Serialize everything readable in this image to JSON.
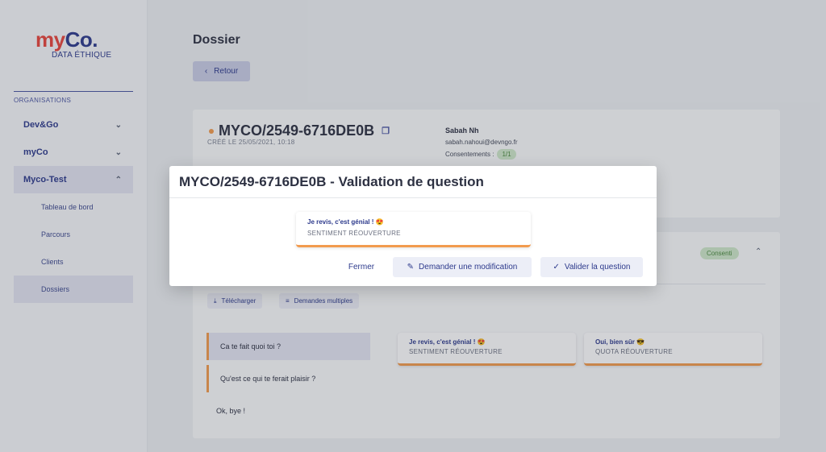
{
  "sidebar": {
    "logo_my": "my",
    "logo_co": "Co.",
    "logo_sub": "DATA ÉTHIQUE",
    "heading": "ORGANISATIONS",
    "orgs": [
      {
        "label": "Dev&Go",
        "expanded": false
      },
      {
        "label": "myCo",
        "expanded": false
      },
      {
        "label": "Myco-Test",
        "expanded": true
      }
    ],
    "subitems": [
      "Tableau de bord",
      "Parcours",
      "Clients",
      "Dossiers"
    ],
    "active_subitem": "Dossiers"
  },
  "page": {
    "title": "Dossier",
    "back_label": "Retour"
  },
  "dossier": {
    "id": "MYCO/2549-6716DE0B",
    "created": "CRÉÉ LE 25/05/2021, 10:18",
    "client_name": "Sabah Nh",
    "client_email": "sabah.nahoui@devngo.fr",
    "consents_label": "Consentements :",
    "consents_value": "1/1"
  },
  "section": {
    "status": "Consenti",
    "download_label": "Télécharger",
    "multi_label": "Demandes multiples",
    "questions": [
      "Ca te fait quoi toi ?",
      "Qu'est ce qui te ferait plaisir ?",
      "Ok, bye !"
    ],
    "answers": [
      {
        "title": "Je revis, c'est génial ! 😍",
        "subtitle": "SENTIMENT RÉOUVERTURE"
      },
      {
        "title": "Oui, bien sûr 😎",
        "subtitle": "QUOTA RÉOUVERTURE"
      }
    ]
  },
  "modal": {
    "title": "MYCO/2549-6716DE0B - Validation de question",
    "answer_title": "Je revis, c'est génial ! 😍",
    "answer_subtitle": "SENTIMENT RÉOUVERTURE",
    "close_label": "Fermer",
    "modify_label": "Demander une modification",
    "validate_label": "Valider la question"
  },
  "colors": {
    "accent": "#2d3a8c",
    "brand_red": "#e8453c",
    "orange": "#f29b4e",
    "green_badge": "#cfe8c9"
  }
}
